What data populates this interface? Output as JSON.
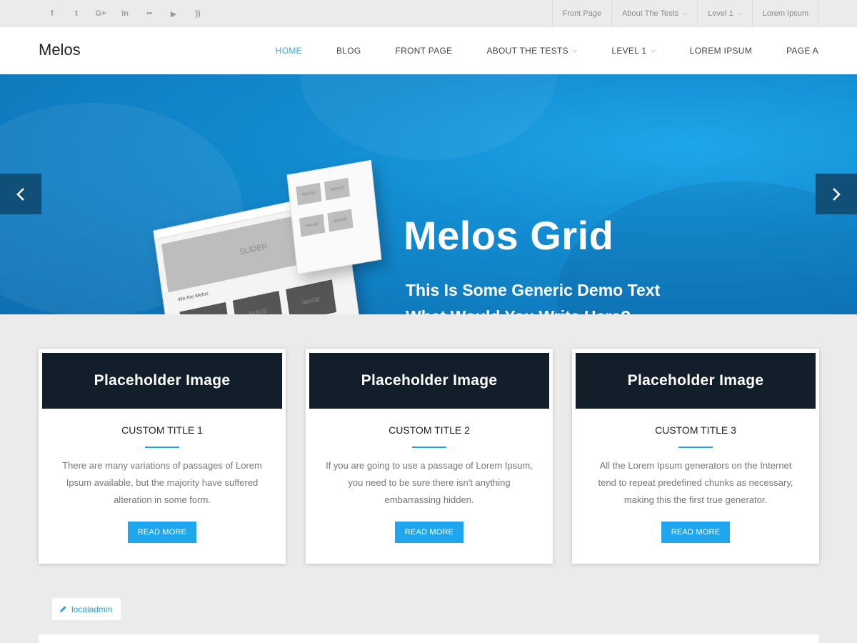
{
  "topbar": {
    "social": [
      {
        "icon": "facebook-icon",
        "glyph": "f"
      },
      {
        "icon": "twitter-icon",
        "glyph": "t"
      },
      {
        "icon": "google-plus-icon",
        "glyph": "G+"
      },
      {
        "icon": "linkedin-icon",
        "glyph": "in"
      },
      {
        "icon": "flickr-icon",
        "glyph": "••"
      },
      {
        "icon": "youtube-icon",
        "glyph": "▶"
      },
      {
        "icon": "rss-icon",
        "glyph": "))"
      }
    ],
    "menu": [
      {
        "label": "Front Page",
        "has_dropdown": false
      },
      {
        "label": "About The Tests",
        "has_dropdown": true
      },
      {
        "label": "Level 1",
        "has_dropdown": true
      },
      {
        "label": "Lorem Ipsum",
        "has_dropdown": false
      }
    ]
  },
  "header": {
    "logo": "Melos",
    "nav": [
      {
        "label": "HOME",
        "active": true,
        "has_dropdown": false
      },
      {
        "label": "BLOG",
        "active": false,
        "has_dropdown": false
      },
      {
        "label": "FRONT PAGE",
        "active": false,
        "has_dropdown": false
      },
      {
        "label": "ABOUT THE TESTS",
        "active": false,
        "has_dropdown": true
      },
      {
        "label": "LEVEL 1",
        "active": false,
        "has_dropdown": true
      },
      {
        "label": "LOREM IPSUM",
        "active": false,
        "has_dropdown": false
      },
      {
        "label": "PAGE A",
        "active": false,
        "has_dropdown": false
      }
    ]
  },
  "hero": {
    "title": "Melos Grid",
    "subtitle_line1": "This Is Some Generic Demo Text",
    "subtitle_line2": "What Would You Write Here?",
    "mockup_slider_label": "SLIDER",
    "mockup_image_label": "IMAGE",
    "mockup_heading": "We Are Melos",
    "slide_count": 3,
    "active_slide": 1
  },
  "cards": [
    {
      "placeholder": "Placeholder Image",
      "title": "CUSTOM TITLE 1",
      "text": "There are many variations of passages of Lorem Ipsum available, but the majority have suffered alteration in some form.",
      "button": "READ MORE"
    },
    {
      "placeholder": "Placeholder Image",
      "title": "CUSTOM TITLE 2",
      "text": "If you are going to use a passage of Lorem Ipsum, you need to be sure there isn't anything embarrassing hidden.",
      "button": "READ MORE"
    },
    {
      "placeholder": "Placeholder Image",
      "title": "CUSTOM TITLE 3",
      "text": "All the Lorem Ipsum generators on the Internet tend to repeat predefined chunks as necessary, making this the first true generator.",
      "button": "READ MORE"
    }
  ],
  "author": {
    "name": "localadmin",
    "icon": "pencil-icon"
  },
  "colors": {
    "accent": "#1fa6ec",
    "active_nav": "#40a9de",
    "placeholder_bg": "#121f2b",
    "arrow_bg": "#0f4f78"
  }
}
